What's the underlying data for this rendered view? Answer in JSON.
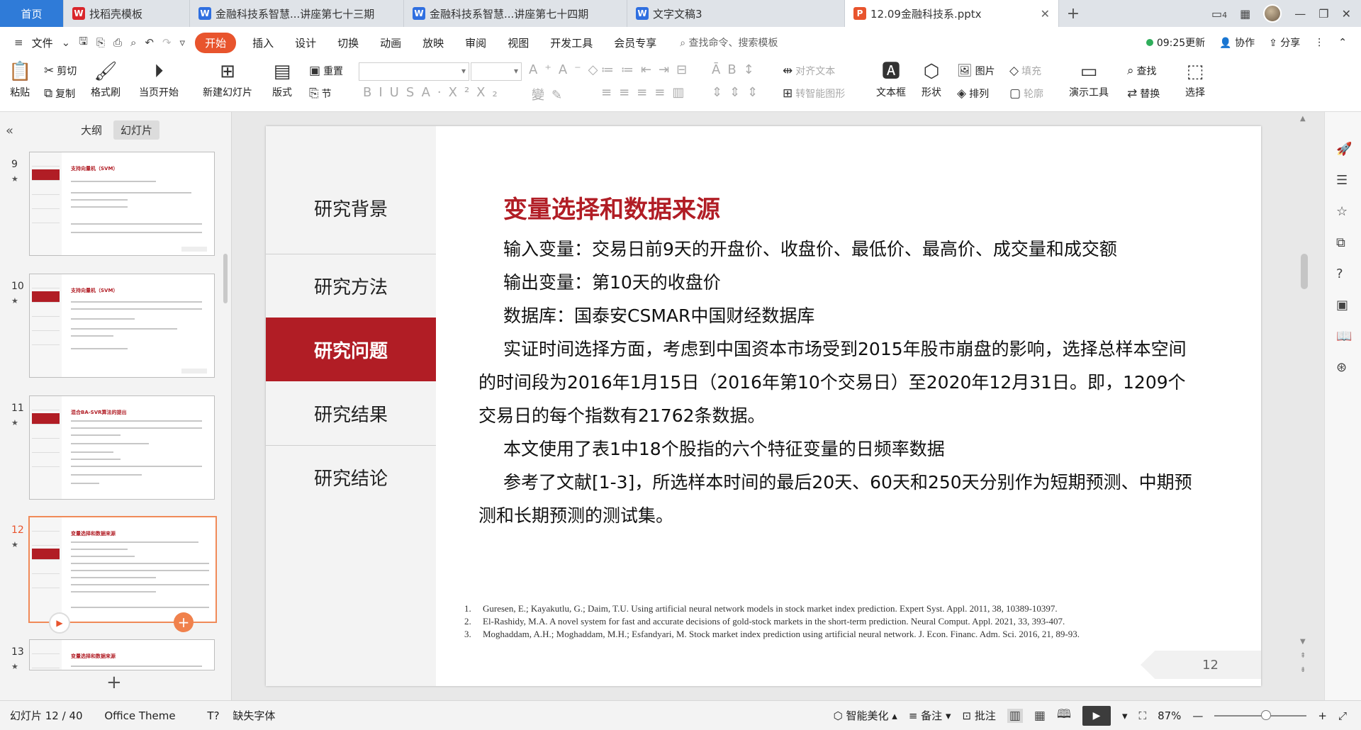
{
  "tabs": {
    "home": "首页",
    "items": [
      {
        "label": "找稻壳模板",
        "icon": "wps-docer-icon",
        "color": "#d9262b",
        "glyph": "W"
      },
      {
        "label": "金融科技系智慧...讲座第七十三期",
        "icon": "word-doc-icon",
        "color": "#2f6fe0",
        "glyph": "W"
      },
      {
        "label": "金融科技系智慧...讲座第七十四期",
        "icon": "word-doc-icon",
        "color": "#2f6fe0",
        "glyph": "W"
      },
      {
        "label": "文字文稿3",
        "icon": "word-doc-icon",
        "color": "#2f6fe0",
        "glyph": "W"
      },
      {
        "label": "12.09金融科技系.pptx",
        "icon": "ppt-doc-icon",
        "color": "#e8542d",
        "glyph": "P"
      }
    ],
    "page_count_badge": "4"
  },
  "menu": {
    "file": "文件",
    "items": [
      "开始",
      "插入",
      "设计",
      "切换",
      "动画",
      "放映",
      "审阅",
      "视图",
      "开发工具",
      "会员专享"
    ],
    "search": "查找命令、搜索模板",
    "sync_time": "09:25更新",
    "collab": "协作",
    "share": "分享"
  },
  "ribbon": {
    "paste": "粘贴",
    "cut": "剪切",
    "copy": "复制",
    "format_painter": "格式刷",
    "from_current": "当页开始",
    "new_slide": "新建幻灯片",
    "layout": "版式",
    "reset": "重置",
    "section": "节",
    "align_text": "对齐文本",
    "smart_shape": "转智能图形",
    "textbox": "文本框",
    "shape": "形状",
    "picture": "图片",
    "fill": "填充",
    "arrange": "排列",
    "outline": "轮廓",
    "present_tools": "演示工具",
    "find": "查找",
    "replace": "替换",
    "select": "选择"
  },
  "panel": {
    "outline_tab": "大纲",
    "slides_tab": "幻灯片"
  },
  "thumbnails": [
    {
      "num": "9",
      "title": "支持向量机（SVM）"
    },
    {
      "num": "10",
      "title": "支持向量机（SVM）"
    },
    {
      "num": "11",
      "title": "混合BA-SVR算法的提出"
    },
    {
      "num": "12",
      "title": "变量选择和数据来源"
    },
    {
      "num": "13",
      "title": "变量选择和数据来源"
    }
  ],
  "slide": {
    "nav": [
      "研究背景",
      "研究方法",
      "研究问题",
      "研究结果",
      "研究结论"
    ],
    "active_nav": "研究问题",
    "title": "变量选择和数据来源",
    "lines": {
      "input_vars": "输入变量：交易日前9天的开盘价、收盘价、最低价、最高价、成交量和成交额",
      "output_var": "输出变量：第10天的收盘价",
      "database": "数据库：国泰安CSMAR中国财经数据库",
      "period": "实证时间选择方面，考虑到中国资本市场受到2015年股市崩盘的影响，选择总样本空间的时间段为2016年1月15日（2016年第10个交易日）至2020年12月31日。即，1209个交易日的每个指数有21762条数据。",
      "features": "本文使用了表1中18个股指的六个特征变量的日频率数据",
      "testsets": "参考了文献[1-3]，所选样本时间的最后20天、60天和250天分别作为短期预测、中期预测和长期预测的测试集。"
    },
    "references": [
      {
        "num": "1.",
        "text": "Guresen, E.; Kayakutlu, G.; Daim, T.U. Using artificial neural network models in stock market index prediction. Expert Syst. Appl. 2011, 38, 10389-10397."
      },
      {
        "num": "2.",
        "text": "El-Rashidy, M.A. A novel system for fast and accurate decisions of gold-stock markets in the short-term prediction. Neural Comput. Appl. 2021, 33, 393-407."
      },
      {
        "num": "3.",
        "text": "Moghaddam, A.H.; Moghaddam, M.H.; Esfandyari, M. Stock market index prediction using artificial neural network. J. Econ. Financ. Adm. Sci. 2016, 21, 89-93."
      }
    ],
    "page_number": "12"
  },
  "status": {
    "slide_counter": "幻灯片 12 / 40",
    "theme": "Office Theme",
    "missing_font": "缺失字体",
    "beautify": "智能美化",
    "notes": "备注",
    "comments": "批注",
    "zoom": "87%",
    "zoom_level": 0.87
  },
  "colors": {
    "accent_red": "#b11d25",
    "start_orange": "#e8542d",
    "home_blue": "#2f7bd8"
  }
}
